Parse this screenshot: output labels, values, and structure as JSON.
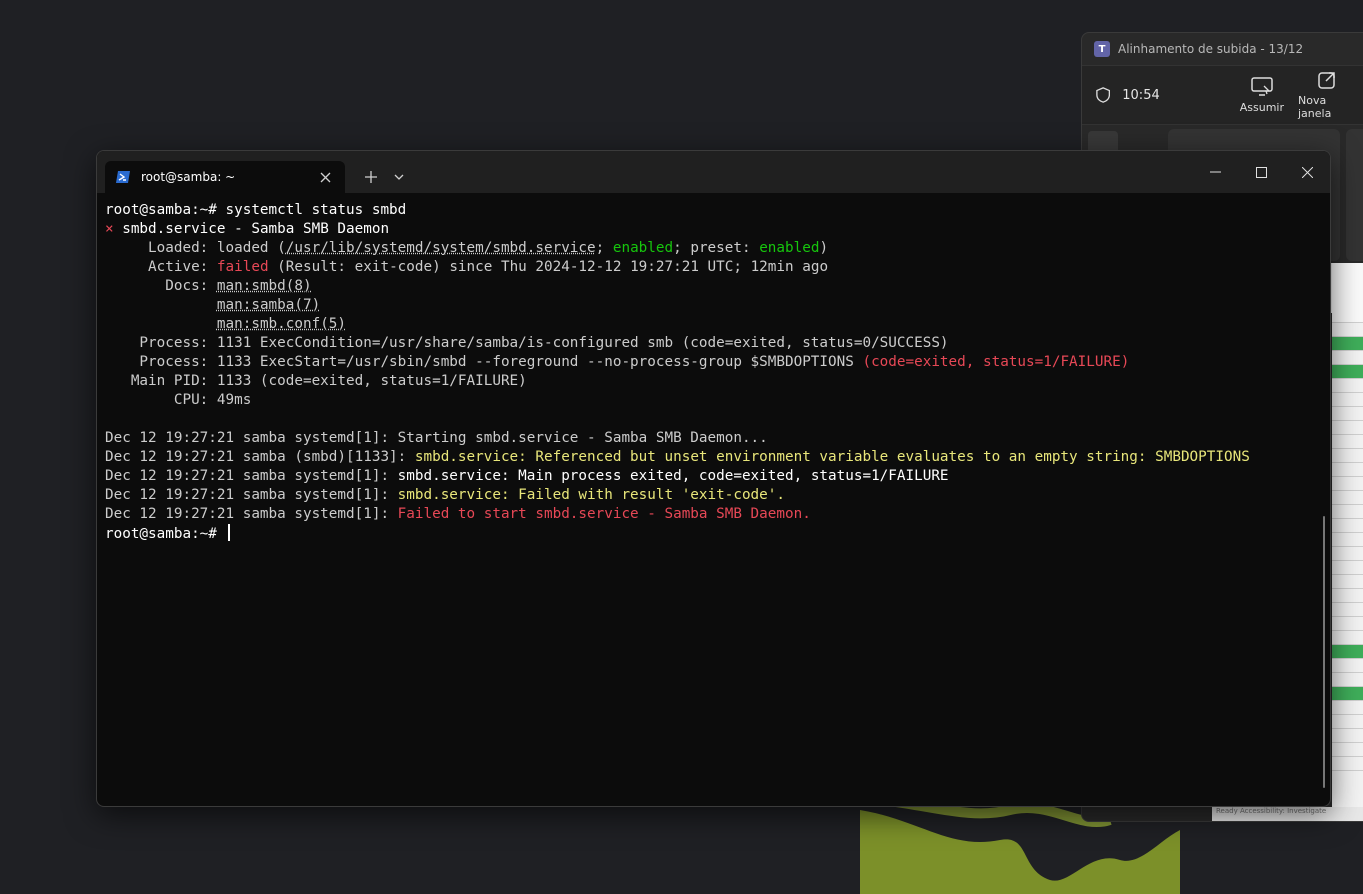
{
  "teams": {
    "title": "Alinhamento de subida - 13/12",
    "time": "10:54",
    "assume_label": "Assumir",
    "new_window_label": "Nova janela"
  },
  "terminal": {
    "tab_title": "root@samba: ~",
    "lines": [
      {
        "segments": [
          {
            "text": "root@samba:~# systemctl status smbd",
            "cls": "c-white"
          }
        ]
      },
      {
        "segments": [
          {
            "text": "× ",
            "cls": "c-red"
          },
          {
            "text": "smbd.service - Samba SMB Daemon",
            "cls": "c-white"
          }
        ]
      },
      {
        "segments": [
          {
            "text": "     Loaded: loaded (",
            "cls": ""
          },
          {
            "text": "/usr/lib/systemd/system/smbd.service",
            "cls": "ul"
          },
          {
            "text": "; ",
            "cls": ""
          },
          {
            "text": "enabled",
            "cls": "c-green"
          },
          {
            "text": "; preset: ",
            "cls": ""
          },
          {
            "text": "enabled",
            "cls": "c-green"
          },
          {
            "text": ")",
            "cls": ""
          }
        ]
      },
      {
        "segments": [
          {
            "text": "     Active: ",
            "cls": ""
          },
          {
            "text": "failed",
            "cls": "c-red"
          },
          {
            "text": " (Result: exit-code) since Thu 2024-12-12 19:27:21 UTC; 12min ago",
            "cls": ""
          }
        ]
      },
      {
        "segments": [
          {
            "text": "       Docs: ",
            "cls": ""
          },
          {
            "text": "man:smbd(8)",
            "cls": "ul"
          }
        ]
      },
      {
        "segments": [
          {
            "text": "             ",
            "cls": ""
          },
          {
            "text": "man:samba(7)",
            "cls": "ul"
          }
        ]
      },
      {
        "segments": [
          {
            "text": "             ",
            "cls": ""
          },
          {
            "text": "man:smb.conf(5)",
            "cls": "ul"
          }
        ]
      },
      {
        "segments": [
          {
            "text": "    Process: 1131 ExecCondition=/usr/share/samba/is-configured smb (code=exited, status=0/SUCCESS)",
            "cls": ""
          }
        ]
      },
      {
        "segments": [
          {
            "text": "    Process: 1133 ExecStart=/usr/sbin/smbd --foreground --no-process-group $SMBDOPTIONS ",
            "cls": ""
          },
          {
            "text": "(code=exited, status=1/FAILURE)",
            "cls": "c-red"
          }
        ]
      },
      {
        "segments": [
          {
            "text": "   Main PID: 1133 (code=exited, status=1/FAILURE)",
            "cls": ""
          }
        ]
      },
      {
        "segments": [
          {
            "text": "        CPU: 49ms",
            "cls": ""
          }
        ]
      },
      {
        "segments": [
          {
            "text": "",
            "cls": ""
          }
        ]
      },
      {
        "segments": [
          {
            "text": "Dec 12 19:27:21 samba systemd[1]: Starting smbd.service - Samba SMB Daemon...",
            "cls": ""
          }
        ]
      },
      {
        "segments": [
          {
            "text": "Dec 12 19:27:21 samba (smbd)[1133]: ",
            "cls": ""
          },
          {
            "text": "smbd.service: Referenced but unset environment variable evaluates to an empty string: SMBDOPTIONS",
            "cls": "c-khaki"
          }
        ]
      },
      {
        "segments": [
          {
            "text": "Dec 12 19:27:21 samba systemd[1]: ",
            "cls": ""
          },
          {
            "text": "smbd.service: Main process exited, code=exited, status=1/FAILURE",
            "cls": "c-white"
          }
        ]
      },
      {
        "segments": [
          {
            "text": "Dec 12 19:27:21 samba systemd[1]: ",
            "cls": ""
          },
          {
            "text": "smbd.service: Failed with result 'exit-code'.",
            "cls": "c-khaki"
          }
        ]
      },
      {
        "segments": [
          {
            "text": "Dec 12 19:27:21 samba systemd[1]: ",
            "cls": ""
          },
          {
            "text": "Failed to start smbd.service - Samba SMB Daemon.",
            "cls": "c-red"
          }
        ]
      },
      {
        "segments": [
          {
            "text": "root@samba:~# ",
            "cls": "c-white"
          }
        ],
        "cursor": true
      }
    ]
  },
  "excel": {
    "status_text": "Ready   Accessibility: Investigate"
  }
}
